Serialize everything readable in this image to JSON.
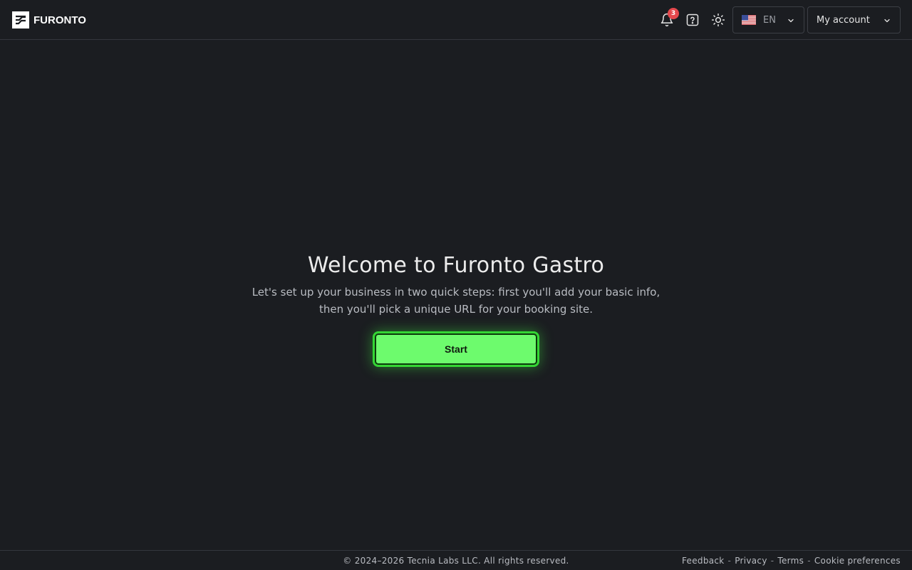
{
  "header": {
    "logo_text": "FURONTO",
    "notifications": {
      "icon": "bell-icon",
      "count": "3"
    },
    "help_icon": "question-icon",
    "theme_icon": "sun-icon",
    "language": {
      "flag": "us-flag-icon",
      "label": "EN"
    },
    "account": {
      "label": "My account"
    }
  },
  "main": {
    "title": "Welcome to Furonto Gastro",
    "subtitle": "Let's set up your business in two quick steps: first you'll add your basic info, then you'll pick a unique URL for your booking site.",
    "start_label": "Start"
  },
  "footer": {
    "copyright": "© 2024–2026 Tecnia Labs LLC. All rights reserved.",
    "links": {
      "feedback": "Feedback",
      "privacy": "Privacy",
      "terms": "Terms",
      "cookies": "Cookie preferences"
    },
    "separator": "-"
  },
  "colors": {
    "background": "#1b1d21",
    "accent_green": "#6dfb6d",
    "badge_red": "#e5484d"
  }
}
